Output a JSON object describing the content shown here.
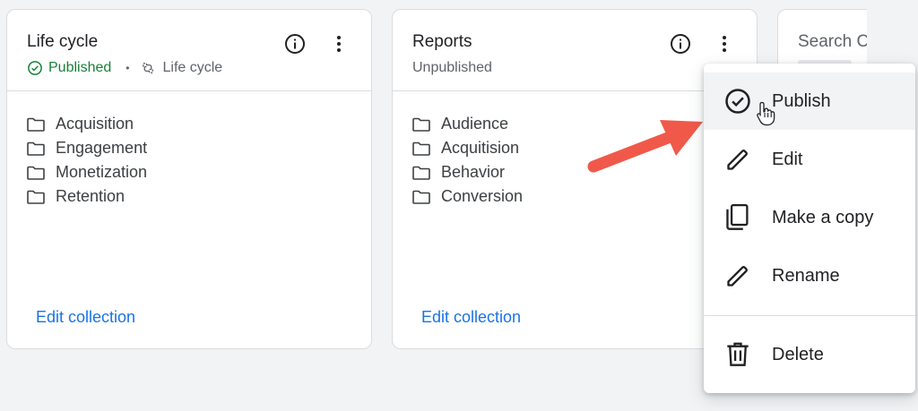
{
  "cards": [
    {
      "title": "Life cycle",
      "status": "Published",
      "tag": "Life cycle",
      "folders": [
        "Acquisition",
        "Engagement",
        "Monetization",
        "Retention"
      ],
      "edit_label": "Edit collection"
    },
    {
      "title": "Reports",
      "status": "Unpublished",
      "folders": [
        "Audience",
        "Acquitision",
        "Behavior",
        "Conversion"
      ],
      "edit_label": "Edit collection"
    },
    {
      "title": "Search C"
    }
  ],
  "menu": {
    "items": [
      {
        "label": "Publish",
        "icon": "check-circle-icon"
      },
      {
        "label": "Edit",
        "icon": "pencil-icon"
      },
      {
        "label": "Make a copy",
        "icon": "copy-icon"
      },
      {
        "label": "Rename",
        "icon": "pencil-icon"
      },
      {
        "label": "Delete",
        "icon": "trash-icon"
      }
    ]
  },
  "colors": {
    "published_green": "#188038",
    "link_blue": "#1a73e8",
    "annotation_arrow": "#f0594a"
  }
}
